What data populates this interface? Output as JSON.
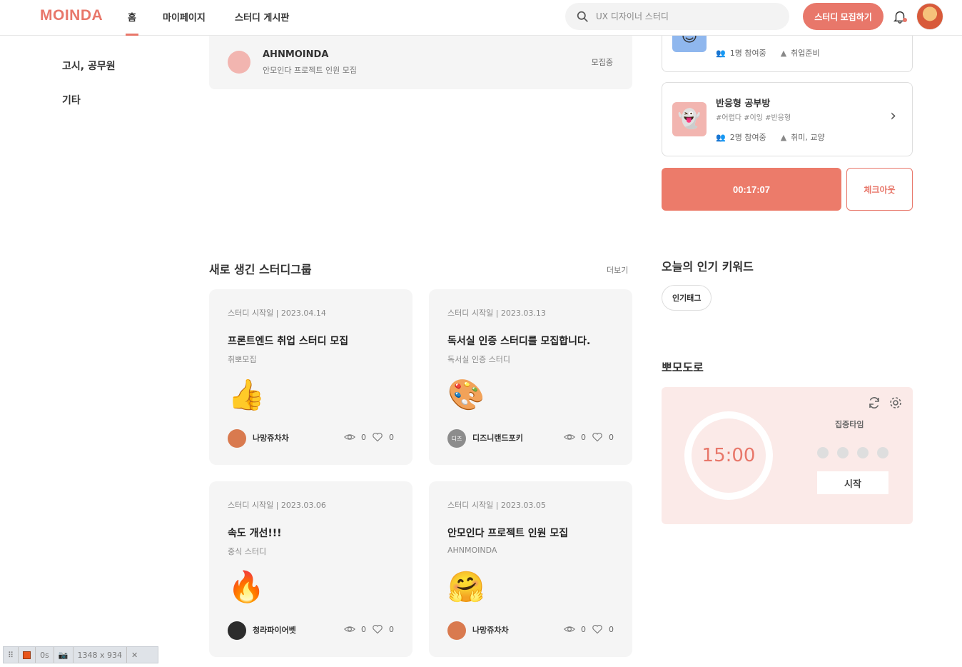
{
  "header": {
    "logo": "MOINDA",
    "nav": [
      {
        "label": "홈"
      },
      {
        "label": "마이페이지"
      },
      {
        "label": "스터디 게시판"
      }
    ],
    "search_placeholder": "UX 디자이너 스터디",
    "recruit_label": "스터디 모집하기"
  },
  "sidebar": {
    "items": [
      {
        "label": "고시, 공무원"
      },
      {
        "label": "기타"
      }
    ]
  },
  "my_study": {
    "name": "AHNMOINDA",
    "desc": "안모인다 프로젝트 인원 모집",
    "status": "모집중"
  },
  "rooms": [
    {
      "title": "",
      "tags": "",
      "members": "1명 참여중",
      "category": "취업준비",
      "thumb_bg": "#8fb7ee"
    },
    {
      "title": "반응형 공부방",
      "tags": "#어렵다 #이잉 #반응형",
      "members": "2명 참여중",
      "category": "취미, 교양",
      "thumb_bg": "#f2b5b0"
    }
  ],
  "session": {
    "timer": "00:17:07",
    "checkout_label": "체크아웃"
  },
  "new_groups": {
    "title": "새로 생긴 스터디그룹",
    "more_label": "더보기",
    "cards": [
      {
        "date_label": "스터디 시작일 | 2023.04.14",
        "title": "프론트엔드 취업 스터디 모집",
        "subtitle": "취뽀모집",
        "emoji": "👍",
        "author": "나망쥬차차",
        "avatar_text": "",
        "avatar_color": "#d97a4f",
        "views": "0",
        "likes": "0"
      },
      {
        "date_label": "스터디 시작일 | 2023.03.13",
        "title": "독서실 인증 스터디를 모집합니다.",
        "subtitle": "독서실 인증 스터디",
        "emoji": "🎨",
        "author": "디즈니랜드포키",
        "avatar_text": "디즈",
        "avatar_color": "#8c8c8c",
        "views": "0",
        "likes": "0"
      },
      {
        "date_label": "스터디 시작일 | 2023.03.06",
        "title": "속도 개선!!!",
        "subtitle": "중식 스터디",
        "emoji": "🔥",
        "author": "청라파이어벳",
        "avatar_text": "",
        "avatar_color": "#2c2c2c",
        "views": "0",
        "likes": "0"
      },
      {
        "date_label": "스터디 시작일 | 2023.03.05",
        "title": "안모인다 프로젝트 인원 모집",
        "subtitle": "AHNMOINDA",
        "emoji": "🤗",
        "author": "나망쥬차차",
        "avatar_text": "",
        "avatar_color": "#d97a4f",
        "views": "0",
        "likes": "0"
      }
    ]
  },
  "keywords": {
    "title": "오늘의 인기 키워드",
    "tags": [
      "인기태그"
    ]
  },
  "pomodoro": {
    "title": "뽀모도로",
    "time": "15:00",
    "mode": "집중타임",
    "start_label": "시작"
  },
  "devbar": {
    "size_label": "1348 x 934",
    "counter": "0s"
  },
  "colors": {
    "accent": "#e8776a",
    "card_bg": "#f5f5f5",
    "pomodoro_bg": "#fbeae8"
  }
}
